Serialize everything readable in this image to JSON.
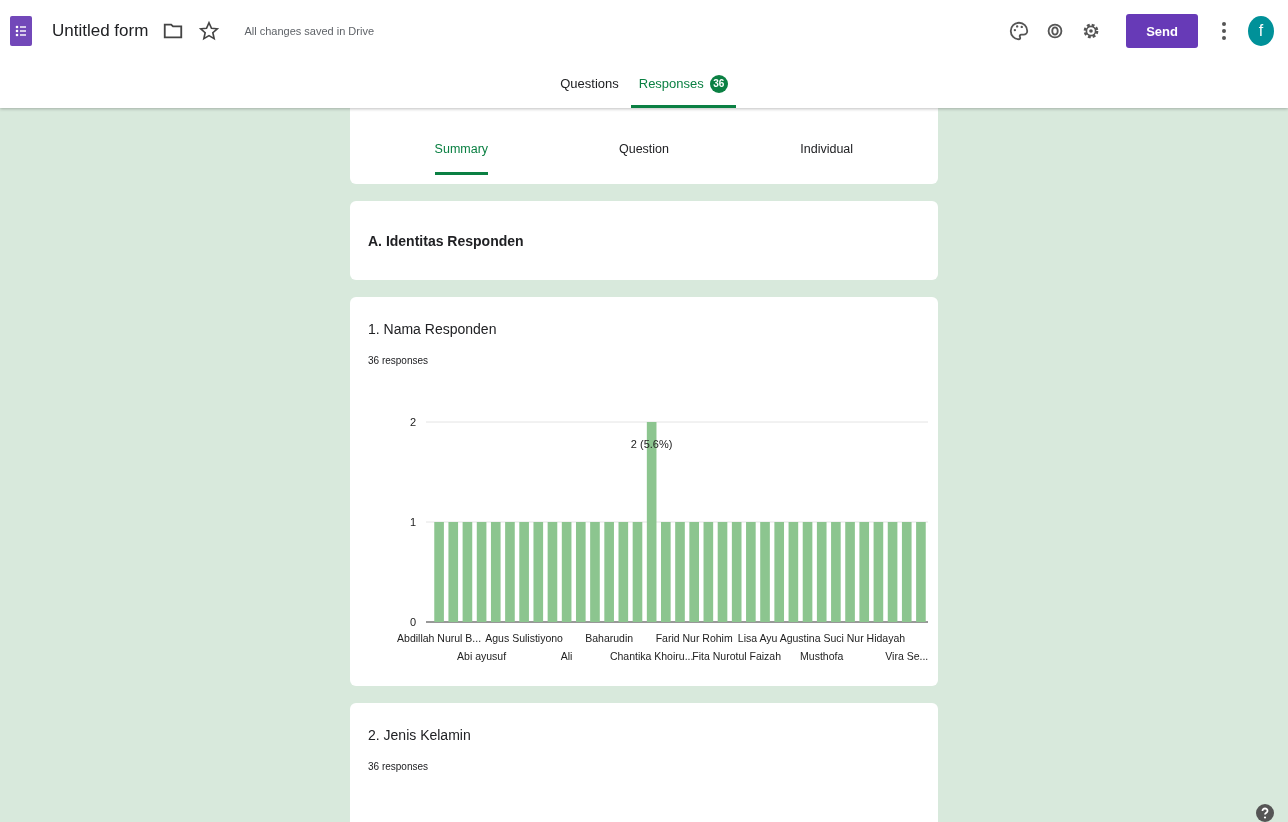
{
  "header": {
    "title": "Untitled form",
    "save_status": "All changes saved in Drive",
    "send_label": "Send",
    "avatar_letter": "f"
  },
  "main_tabs": [
    {
      "label": "Questions",
      "selected": false
    },
    {
      "label": "Responses",
      "selected": true,
      "badge": "36"
    }
  ],
  "view_tabs": [
    {
      "label": "Summary",
      "selected": true
    },
    {
      "label": "Question",
      "selected": false
    },
    {
      "label": "Individual",
      "selected": false
    }
  ],
  "section": {
    "title": "A. Identitas Responden"
  },
  "questions": [
    {
      "title": "1. Nama Responden",
      "count": "36 responses",
      "chart_data": {
        "type": "bar",
        "orientation": "vertical",
        "ylim": [
          0,
          2
        ],
        "yticks": [
          0,
          1,
          2
        ],
        "values": [
          1,
          1,
          1,
          1,
          1,
          1,
          1,
          1,
          1,
          1,
          1,
          1,
          1,
          1,
          1,
          2,
          1,
          1,
          1,
          1,
          1,
          1,
          1,
          1,
          1,
          1,
          1,
          1,
          1,
          1,
          1,
          1,
          1,
          1,
          1
        ],
        "categories": [
          "Abdillah Nurul B...",
          null,
          null,
          "Abi ayusuf",
          null,
          null,
          "Agus Sulistiyono",
          null,
          null,
          "Ali",
          null,
          null,
          "Baharudin",
          null,
          null,
          "Chantika Khoiru...",
          null,
          null,
          "Farid Nur Rohim",
          null,
          null,
          "Fita Nurotul Faizah",
          null,
          null,
          "Lisa Ayu Agustina",
          null,
          null,
          "Musthofa",
          null,
          null,
          "Suci Nur Hidayah",
          null,
          null,
          "Vira Se...",
          null
        ],
        "annotations": [
          {
            "text": "2 (5.6%)",
            "x": "Chantika Khoiru...",
            "y": 2
          }
        ]
      }
    },
    {
      "title": "2. Jenis Kelamin",
      "count": "36 responses"
    }
  ]
}
